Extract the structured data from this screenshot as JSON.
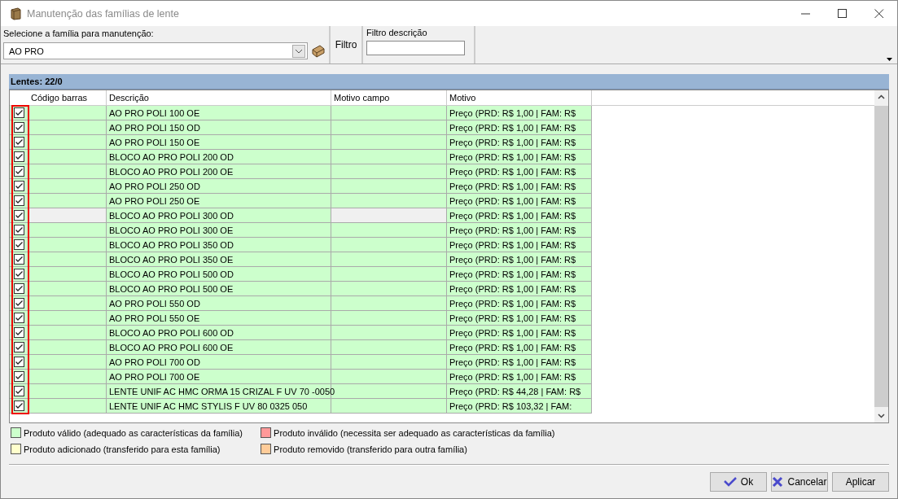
{
  "window": {
    "title": "Manutenção das famílias de lente"
  },
  "family": {
    "label": "Selecione a família para manutenção:",
    "value": "AO PRO"
  },
  "filter": {
    "button": "Filtro",
    "label": "Filtro descrição"
  },
  "lenses": {
    "header": "Lentes: 22/0",
    "columns": [
      "Código barras",
      "Descrição",
      "Motivo campo",
      "Motivo"
    ],
    "rows": [
      {
        "checked": true,
        "selected": false,
        "color": "#ccffcc",
        "description": "AO PRO POLI 100 OE",
        "reason": "Preço (PRD: R$ 1,00 | FAM: R$"
      },
      {
        "checked": true,
        "selected": false,
        "color": "#ccffcc",
        "description": "AO PRO POLI 150 OD",
        "reason": "Preço (PRD: R$ 1,00 | FAM: R$"
      },
      {
        "checked": true,
        "selected": false,
        "color": "#ccffcc",
        "description": "AO PRO POLI 150 OE",
        "reason": "Preço (PRD: R$ 1,00 | FAM: R$"
      },
      {
        "checked": true,
        "selected": false,
        "color": "#ccffcc",
        "description": "BLOCO AO PRO POLI 200 OD",
        "reason": "Preço (PRD: R$ 1,00 | FAM: R$"
      },
      {
        "checked": true,
        "selected": false,
        "color": "#ccffcc",
        "description": "BLOCO AO PRO POLI 200 OE",
        "reason": "Preço (PRD: R$ 1,00 | FAM: R$"
      },
      {
        "checked": true,
        "selected": false,
        "color": "#ccffcc",
        "description": "AO PRO POLI 250 OD",
        "reason": "Preço (PRD: R$ 1,00 | FAM: R$"
      },
      {
        "checked": true,
        "selected": false,
        "color": "#ccffcc",
        "description": "AO PRO POLI 250 OE",
        "reason": "Preço (PRD: R$ 1,00 | FAM: R$"
      },
      {
        "checked": true,
        "selected": true,
        "color": "#ccffcc",
        "description": "BLOCO AO PRO POLI 300 OD",
        "reason": "Preço (PRD: R$ 1,00 | FAM: R$"
      },
      {
        "checked": true,
        "selected": false,
        "color": "#ccffcc",
        "description": "BLOCO AO PRO POLI 300 OE",
        "reason": "Preço (PRD: R$ 1,00 | FAM: R$"
      },
      {
        "checked": true,
        "selected": false,
        "color": "#ccffcc",
        "description": "BLOCO AO PRO POLI 350 OD",
        "reason": "Preço (PRD: R$ 1,00 | FAM: R$"
      },
      {
        "checked": true,
        "selected": false,
        "color": "#ccffcc",
        "description": "BLOCO AO PRO POLI 350 OE",
        "reason": "Preço (PRD: R$ 1,00 | FAM: R$"
      },
      {
        "checked": true,
        "selected": false,
        "color": "#ccffcc",
        "description": "BLOCO AO PRO POLI 500 OD",
        "reason": "Preço (PRD: R$ 1,00 | FAM: R$"
      },
      {
        "checked": true,
        "selected": false,
        "color": "#ccffcc",
        "description": "BLOCO AO PRO POLI 500 OE",
        "reason": "Preço (PRD: R$ 1,00 | FAM: R$"
      },
      {
        "checked": true,
        "selected": false,
        "color": "#ccffcc",
        "description": "AO PRO POLI 550 OD",
        "reason": "Preço (PRD: R$ 1,00 | FAM: R$"
      },
      {
        "checked": true,
        "selected": false,
        "color": "#ccffcc",
        "description": "AO PRO POLI 550 OE",
        "reason": "Preço (PRD: R$ 1,00 | FAM: R$"
      },
      {
        "checked": true,
        "selected": false,
        "color": "#ccffcc",
        "description": "BLOCO AO PRO POLI 600 OD",
        "reason": "Preço (PRD: R$ 1,00 | FAM: R$"
      },
      {
        "checked": true,
        "selected": false,
        "color": "#ccffcc",
        "description": "BLOCO AO PRO POLI 600 OE",
        "reason": "Preço (PRD: R$ 1,00 | FAM: R$"
      },
      {
        "checked": true,
        "selected": false,
        "color": "#ccffcc",
        "description": "AO PRO POLI 700 OD",
        "reason": "Preço (PRD: R$ 1,00 | FAM: R$"
      },
      {
        "checked": true,
        "selected": false,
        "color": "#ccffcc",
        "description": "AO PRO POLI 700 OE",
        "reason": "Preço (PRD: R$ 1,00 | FAM: R$"
      },
      {
        "checked": true,
        "selected": false,
        "color": "#ccffcc",
        "description": "LENTE UNIF AC HMC ORMA 15 CRIZAL F UV 70 -0050",
        "reason": "Preço (PRD: R$ 44,28 | FAM: R$"
      },
      {
        "checked": true,
        "selected": false,
        "color": "#ccffcc",
        "description": "LENTE UNIF AC HMC STYLIS F UV 80 0325 050",
        "reason": "Preço (PRD: R$ 103,32 | FAM:"
      }
    ]
  },
  "legend": [
    {
      "color": "#ccffcc",
      "label": "Produto válido (adequado as características da família)"
    },
    {
      "color": "#ff9999",
      "label": "Produto inválido (necessita ser adequado as características da família)"
    },
    {
      "color": "#ffffcc",
      "label": "Produto adicionado (transferido para esta família)"
    },
    {
      "color": "#ffcc99",
      "label": "Produto removido (transferido para outra família)"
    }
  ],
  "buttons": [
    {
      "kind": "ok",
      "label": "Ok"
    },
    {
      "kind": "cancel",
      "label": "Cancelar"
    },
    {
      "kind": "apply",
      "label": "Aplicar"
    }
  ]
}
